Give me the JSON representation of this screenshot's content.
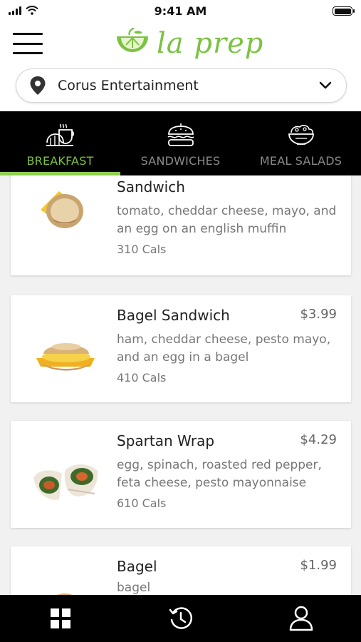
{
  "status_bar": {
    "time": "9:41 AM"
  },
  "header": {
    "brand": "la prep"
  },
  "location": {
    "name": "Corus Entertainment"
  },
  "tabs": [
    {
      "label": "BREAKFAST",
      "active": true
    },
    {
      "label": "SANDWICHES",
      "active": false
    },
    {
      "label": "MEAL SALADS",
      "active": false
    }
  ],
  "items": [
    {
      "name": "Sandwich",
      "price": "",
      "description": "tomato, cheddar cheese, mayo, and an egg on an english muffin",
      "cals": "310 Cals"
    },
    {
      "name": "Bagel Sandwich",
      "price": "$3.99",
      "description": "ham, cheddar cheese, pesto mayo, and an egg in a bagel",
      "cals": "410 Cals"
    },
    {
      "name": "Spartan Wrap",
      "price": "$4.29",
      "description": "egg, spinach, roasted red pepper, feta cheese, pesto mayonnaise",
      "cals": "610 Cals"
    },
    {
      "name": "Bagel",
      "price": "$1.99",
      "description": "bagel",
      "cals": ""
    }
  ],
  "colors": {
    "accent": "#7cc242",
    "tab_bar": "#000000",
    "background": "#f1f1f1"
  },
  "icons": {
    "bottom_nav": [
      "grid-icon",
      "history-icon",
      "profile-icon"
    ],
    "tabs": [
      "breakfast-icon",
      "sandwich-icon",
      "salad-icon"
    ]
  }
}
